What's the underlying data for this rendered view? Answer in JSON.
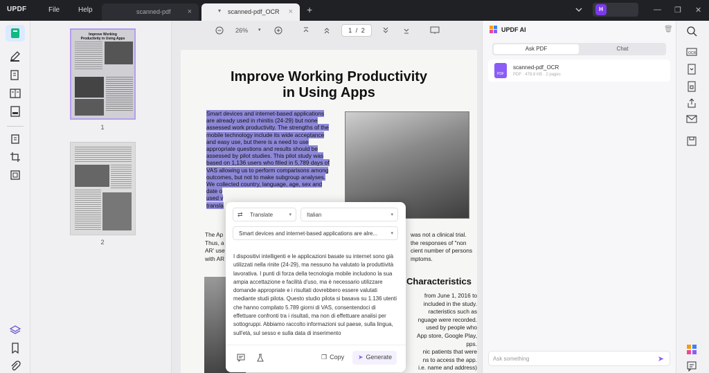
{
  "app": {
    "logo": "UPDF",
    "menu": [
      "File",
      "Help"
    ]
  },
  "tabs": [
    {
      "label": "scanned-pdf",
      "close": "×"
    },
    {
      "label": "scanned-pdf_OCR",
      "close": "×"
    }
  ],
  "new_tab": "+",
  "user": {
    "initial": "H"
  },
  "thumbnails": {
    "pages": [
      "1",
      "2"
    ],
    "page1_title": "Improve Working Productivity in Using Apps"
  },
  "toolbar": {
    "zoom": "26%",
    "page_current": "1",
    "page_sep": "/",
    "page_total": "2"
  },
  "document": {
    "title_line1": "Improve Working Productivity",
    "title_line2": "in Using Apps",
    "highlighted_lines": [
      "Smart devices and internet-based applications",
      "are already used in rhinitis (24-29) but none",
      "assessed work productivity. The strengths of the",
      "mobile technology include its wide acceptance",
      "and easy use, but there is a need to use",
      "appropriate questions and results should be",
      "assessed by pilot studies. This pilot study was",
      "based on 1,136 users who filled in 5,789 days of",
      "VAS allowing us to perform comparisons among",
      "outcomes, but not to make subgroup analyses.",
      "We collected country, language, age, sex and",
      "date o",
      "used v",
      "transla"
    ],
    "left_lines": [
      "The Ap",
      "Thus, a",
      "AR' use",
      "with AR"
    ],
    "right_lines": [
      "was not a clinical trial.",
      "the responses of \"non",
      "cient number of persons",
      "mptoms."
    ],
    "section_heading": "Characteristics",
    "right_lower_lines": [
      "from June 1, 2016 to",
      "included in the study.",
      "racteristics such as",
      "nguage were recorded.",
      "used by people who",
      "App store, Google Play,",
      "pps.",
      "nic patients that were",
      "ns to access the app.",
      "i.e. name and address)"
    ]
  },
  "translate_popup": {
    "mode": "Translate",
    "language": "Italian",
    "source_text": "Smart devices and internet-based applications are alre...",
    "output": "I dispositivi intelligenti e le applicazioni basate su internet sono già utilizzati nella rinite (24-29), ma nessuno ha valutato la produttività lavorativa. I punti di forza della tecnologia mobile includono la sua ampia accettazione e facilità d'uso, ma è necessario utilizzare domande appropriate e i risultati dovrebbero essere valutati mediante studi pilota. Questo studio pilota si basava su 1.136 utenti che hanno compilato 5.789 giorni di VAS, consentendoci di effettuare confronti tra i risultati, ma non di effettuare analisi per sottogruppi. Abbiamo raccolto informazioni sul paese, sulla lingua, sull'età, sul sesso e sulla data di inserimento",
    "copy_label": "Copy",
    "generate_label": "Generate"
  },
  "ai_panel": {
    "title": "UPDF AI",
    "tabs": [
      "Ask PDF",
      "Chat"
    ],
    "file_name": "scanned-pdf_OCR",
    "file_meta": "PDF · 478.8 KB · 2 pages",
    "file_badge": "PDF",
    "input_placeholder": "Ask something"
  },
  "colors": {
    "accent": "#8b5cf6",
    "highlight": "#8d88d8",
    "titlebar": "#202125"
  }
}
